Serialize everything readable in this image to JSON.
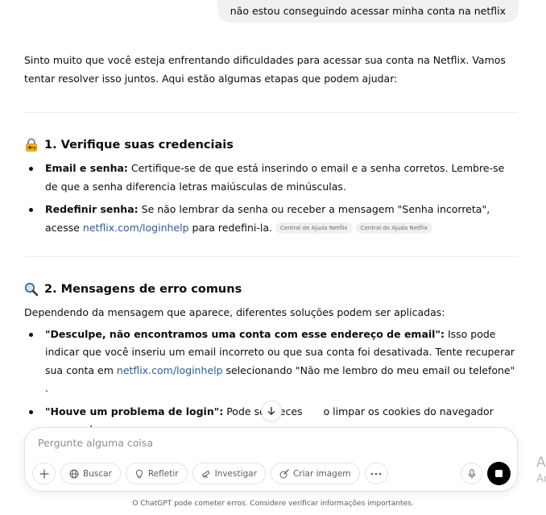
{
  "user_message": "não estou conseguindo acessar minha conta na netflix",
  "response": {
    "intro": "Sinto muito que você esteja enfrentando dificuldades para acessar sua conta na Netflix. Vamos tentar resolver isso juntos. Aqui estão algumas etapas que podem ajudar:",
    "section1": {
      "icon": "lock-with-key-icon",
      "title": "1. Verifique suas credenciais",
      "items": [
        {
          "label": "Email e senha:",
          "text": " Certifique-se de que está inserindo o email e a senha corretos. Lembre-se de que a senha diferencia letras maiúsculas de minúsculas."
        },
        {
          "label": "Redefinir senha:",
          "text": " Se não lembrar da senha ou receber a mensagem \"Senha incorreta\", acesse ",
          "link": "netflix.com/loginhelp",
          "text_after": " para redefini-la.",
          "chips": [
            "Central de Ajuda Netflix",
            "Central de Ajuda Netflix"
          ]
        }
      ]
    },
    "section2": {
      "icon": "magnifying-glass-icon",
      "title": "2. Mensagens de erro comuns",
      "intro": "Dependendo da mensagem que aparece, diferentes soluções podem ser aplicadas:",
      "items": [
        {
          "label": "\"Desculpe, não encontramos uma conta com esse endereço de email\":",
          "text": " Isso pode indicar que você inseriu um email incorreto ou que sua conta foi desativada. Tente recuperar sua conta em ",
          "link": "netflix.com/loginhelp",
          "text_after": " selecionando \"Não me lembro do meu email ou telefone\" ."
        },
        {
          "label": "\"Houve um problema de login\":",
          "text": " Pode ser neces",
          "text_after": "o limpar os cookies do navegador acessando"
        }
      ]
    }
  },
  "composer": {
    "placeholder": "Pergunte alguma coisa",
    "tools": {
      "search": "Buscar",
      "reason": "Refletir",
      "research": "Investigar",
      "image": "Criar imagem"
    }
  },
  "footer": "O ChatGPT pode cometer erros. Considere verificar informações importantes.",
  "side_partial": {
    "line1": "A",
    "line2": "Ac"
  },
  "colors": {
    "link": "#2b5a9c",
    "bubble": "#f1f1f1",
    "stop_button": "#000000"
  }
}
